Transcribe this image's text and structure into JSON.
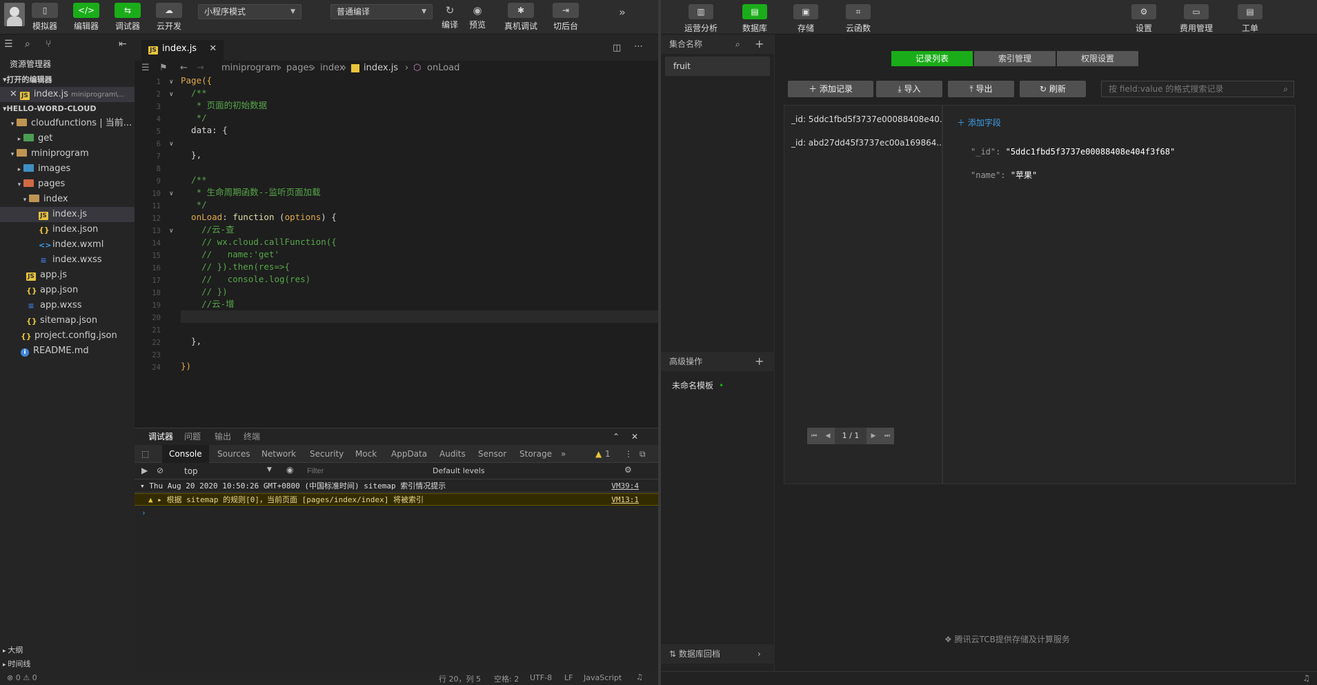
{
  "toolbar": {
    "simulator": "模拟器",
    "editor": "编辑器",
    "debugger": "调试器",
    "cloud_dev": "云开发",
    "mode_select": "小程序模式",
    "compile_select": "普通编译",
    "compile": "编译",
    "preview": "预览",
    "real_debug": "真机调试",
    "background": "切后台"
  },
  "sidebar": {
    "title": "资源管理器",
    "open_editors": "打开的编辑器",
    "open_file": "index.js",
    "open_file_path": "miniprogram\\...",
    "project": "HELLO-WORD-CLOUD",
    "tree": [
      {
        "label": "cloudfunctions | 当前...",
        "type": "folder-green"
      },
      {
        "label": "get",
        "type": "folder-green"
      },
      {
        "label": "miniprogram",
        "type": "folder"
      },
      {
        "label": "images",
        "type": "folder-green"
      },
      {
        "label": "pages",
        "type": "folder-red"
      },
      {
        "label": "index",
        "type": "folder"
      },
      {
        "label": "index.js",
        "type": "js"
      },
      {
        "label": "index.json",
        "type": "json"
      },
      {
        "label": "index.wxml",
        "type": "wxml"
      },
      {
        "label": "index.wxss",
        "type": "wxss"
      },
      {
        "label": "app.js",
        "type": "js"
      },
      {
        "label": "app.json",
        "type": "json"
      },
      {
        "label": "app.wxss",
        "type": "wxss"
      },
      {
        "label": "sitemap.json",
        "type": "json"
      },
      {
        "label": "project.config.json",
        "type": "json"
      },
      {
        "label": "README.md",
        "type": "info"
      }
    ],
    "outline": "大纲",
    "timeline": "时间线"
  },
  "editor": {
    "tab": "index.js",
    "breadcrumb": [
      "miniprogram",
      "pages",
      "index",
      "index.js",
      "onLoad"
    ],
    "line_numbers": [
      "1",
      "2",
      "3",
      "4",
      "5",
      "6",
      "7",
      "8",
      "9",
      "10",
      "11",
      "12",
      "13",
      "14",
      "15",
      "16",
      "17",
      "18",
      "19",
      "20",
      "21",
      "22",
      "23",
      "24"
    ],
    "code": {
      "l1": "Page({",
      "l2": "  /**",
      "l3": "   * 页面的初始数据",
      "l4": "   */",
      "l5a": "  data",
      "l5b": ": {",
      "l7": "  },",
      "l9": "  /**",
      "l10": "   * 生命周期函数--监听页面加载",
      "l11": "   */",
      "l12a": "  onLoad",
      "l12b": ": ",
      "l12c": "function",
      "l12d": " (",
      "l12e": "options",
      "l12f": ") {",
      "l13": "    //云-查",
      "l14": "    // wx.cloud.callFunction({",
      "l15": "    //   name:'get'",
      "l16": "    // }).then(res=>{",
      "l17": "    //   console.log(res)",
      "l18": "    // })",
      "l19": "    //云-增",
      "l22": "  },",
      "l24": "})"
    }
  },
  "panel": {
    "tabs": [
      "调试器",
      "问题",
      "输出",
      "终端"
    ],
    "devtools_tabs": [
      "Console",
      "Sources",
      "Network",
      "Security",
      "Mock",
      "AppData",
      "Audits",
      "Sensor",
      "Storage"
    ],
    "warn_count": "1",
    "context": "top",
    "filter_placeholder": "Filter",
    "levels": "Default levels",
    "log1": "Thu Aug 20 2020 10:50:26 GMT+0800 (中国标准时间) sitemap 索引情况提示",
    "log1_src": "VM39:4",
    "log2": "根据 sitemap 的规则[0]，当前页面 [pages/index/index] 将被索引",
    "log2_src": "VM13:1"
  },
  "status": {
    "errors": "⊗ 0 ⚠ 0",
    "position": "行 20，列 5",
    "spaces": "空格: 2",
    "encoding": "UTF-8",
    "eol": "LF",
    "language": "JavaScript"
  },
  "cloud": {
    "nav": [
      "运营分析",
      "数据库",
      "存储",
      "云函数"
    ],
    "nav_right": [
      "设置",
      "费用管理",
      "工单"
    ],
    "collection_header": "集合名称",
    "collection": "fruit",
    "advanced": "高级操作",
    "template": "未命名模板",
    "db_backup": "数据库回档",
    "tabs": [
      "记录列表",
      "索引管理",
      "权限设置"
    ],
    "buttons": [
      "添加记录",
      "导入",
      "导出",
      "刷新"
    ],
    "search_placeholder": "按 field:value 的格式搜索记录",
    "records": [
      "_id: 5ddc1fbd5f3737e00088408e40...",
      "_id: abd27dd45f3737ec00a169864..."
    ],
    "add_field": "添加字段",
    "fields": [
      {
        "key": "\"_id\":",
        "value": "\"5ddc1fbd5f3737e00088408e404f3f68\""
      },
      {
        "key": "\"name\":",
        "value": "\"苹果\""
      }
    ],
    "pager": "1 / 1",
    "footer": "腾讯云TCB提供存储及计算服务",
    "accent": "#1aad19"
  }
}
